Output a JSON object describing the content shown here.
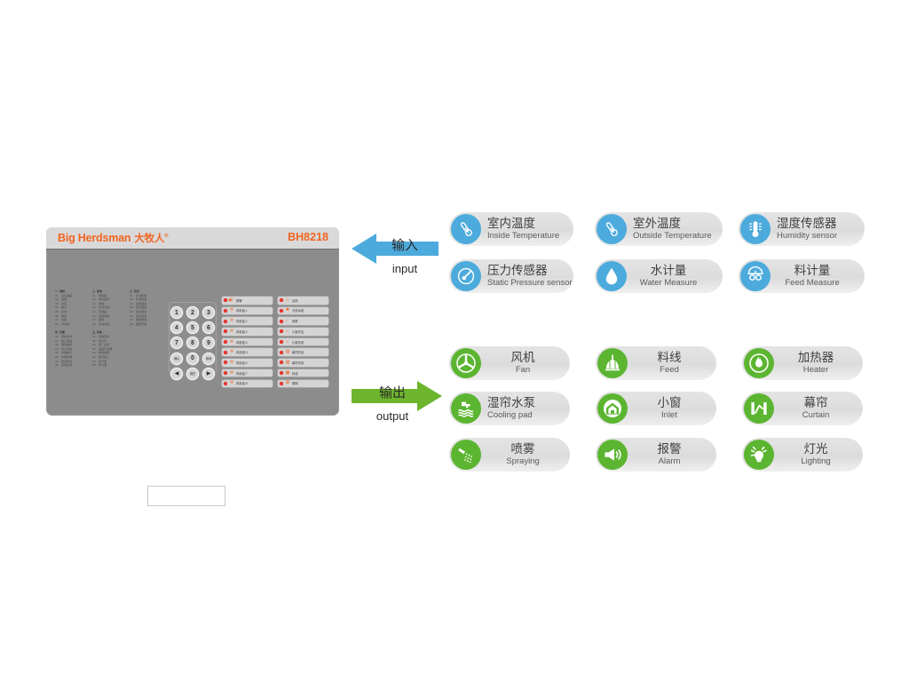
{
  "device": {
    "brand": "Big Herdsman",
    "brand_cn": "大牧人",
    "trademark": "®",
    "model": "BH8218",
    "display_value": "",
    "menu": {
      "groups": [
        {
          "title": "一. 控制",
          "items": [
            {
              "idx": "01",
              "label": "目标温度"
            },
            {
              "idx": "02",
              "label": "湿度"
            },
            {
              "idx": "03",
              "label": "负压"
            },
            {
              "idx": "04",
              "label": "制冷"
            },
            {
              "idx": "05",
              "label": "灯光"
            },
            {
              "idx": "06",
              "label": "饲料"
            },
            {
              "idx": "07",
              "label": "喷雾"
            },
            {
              "idx": "08",
              "label": "风机组"
            }
          ]
        },
        {
          "title": "二. 查询",
          "items": [
            {
              "idx": "11",
              "label": "同机组"
            },
            {
              "idx": "12",
              "label": "同机模式"
            },
            {
              "idx": "13",
              "label": "时钟"
            },
            {
              "idx": "14",
              "label": "生长日龄"
            },
            {
              "idx": "15",
              "label": "折音曲"
            },
            {
              "idx": "16",
              "label": "活用体重"
            },
            {
              "idx": "17",
              "label": "报警"
            },
            {
              "idx": "18",
              "label": "传感校准"
            }
          ]
        },
        {
          "title": "三. 历史",
          "items": [
            {
              "idx": "21",
              "label": "水消耗量"
            },
            {
              "idx": "22",
              "label": "料消耗量"
            },
            {
              "idx": "23",
              "label": "最低温度"
            },
            {
              "idx": "24",
              "label": "最高温度"
            },
            {
              "idx": "25",
              "label": "最低湿度"
            },
            {
              "idx": "26",
              "label": "最高湿度"
            },
            {
              "idx": "27",
              "label": "报警类型"
            },
            {
              "idx": "28",
              "label": "报警开始"
            }
          ]
        }
      ],
      "groups_lower": [
        {
          "title": "四. 设置",
          "items": [
            {
              "idx": "31",
              "label": "更新时间"
            },
            {
              "idx": "32",
              "label": "窗口温度"
            },
            {
              "idx": "33",
              "label": "温度曲线"
            },
            {
              "idx": "34",
              "label": "窗口体重"
            },
            {
              "idx": "35",
              "label": "水量单元"
            },
            {
              "idx": "36",
              "label": "水量参数"
            },
            {
              "idx": "37",
              "label": "变速风机"
            },
            {
              "idx": "38",
              "label": "系统设置"
            }
          ]
        },
        {
          "title": "五. 系统",
          "items": [
            {
              "idx": "61",
              "label": "系统密码"
            },
            {
              "idx": "62",
              "label": "级水平"
            },
            {
              "idx": "63",
              "label": "出厂设置"
            },
            {
              "idx": "64",
              "label": "温度传感器"
            },
            {
              "idx": "65",
              "label": "响音类型"
            },
            {
              "idx": "66",
              "label": "数字输入"
            },
            {
              "idx": "67",
              "label": "水计量"
            },
            {
              "idx": "68",
              "label": "料计量"
            }
          ]
        }
      ]
    },
    "keypad": {
      "rows": [
        [
          "1",
          "2",
          "3"
        ],
        [
          "4",
          "5",
          "6"
        ],
        [
          "7",
          "8",
          "9"
        ],
        [
          "确认",
          "0",
          "取消"
        ],
        [
          "◀",
          "模式",
          "▶"
        ]
      ]
    },
    "indicators": {
      "column_left": [
        {
          "label": "报警",
          "icon": "alarm-horn-icon"
        },
        {
          "label": "风机组 1",
          "icon": "fan-icon"
        },
        {
          "label": "风机组 2",
          "icon": "fan-icon"
        },
        {
          "label": "风机组 3",
          "icon": "fan-icon"
        },
        {
          "label": "风机组 4",
          "icon": "fan-icon"
        },
        {
          "label": "风机组 5",
          "icon": "fan-icon"
        },
        {
          "label": "风机组 6",
          "icon": "fan-icon"
        },
        {
          "label": "风机组 7",
          "icon": "fan-icon"
        },
        {
          "label": "风机组 8",
          "icon": "fan-icon"
        }
      ],
      "column_right": [
        {
          "label": "加热",
          "icon": "flame-icon"
        },
        {
          "label": "冷却水泵",
          "icon": "pump-icon"
        },
        {
          "label": "喷雾",
          "icon": "spray-icon"
        },
        {
          "label": "小窗开启",
          "icon": "inlet-open-icon"
        },
        {
          "label": "小窗关闭",
          "icon": "inlet-close-icon"
        },
        {
          "label": "幕帘开启",
          "icon": "curtain-open-icon"
        },
        {
          "label": "幕帘关闭",
          "icon": "curtain-close-icon"
        },
        {
          "label": "料线",
          "icon": "feed-line-icon"
        },
        {
          "label": "照明",
          "icon": "light-icon"
        }
      ],
      "led_color": "#e8342a"
    }
  },
  "arrows": {
    "input": {
      "cn": "输入",
      "en": "input",
      "color": "#4cabdc",
      "direction": "left"
    },
    "output": {
      "cn": "输出",
      "en": "output",
      "color": "#6cb52d",
      "direction": "right"
    }
  },
  "inputs": {
    "accent": "#4cabdc",
    "cards": [
      {
        "cn": "室内温度",
        "en": "Inside Temperature",
        "icon": "thermometer-icon"
      },
      {
        "cn": "室外温度",
        "en": "Outside Temperature",
        "icon": "thermometer-icon"
      },
      {
        "cn": "湿度传感器",
        "en": "Humidity sensor",
        "icon": "humidity-thermometer-icon"
      },
      {
        "cn": "压力传感器",
        "en": "Static Pressure sensor",
        "icon": "gauge-icon"
      },
      {
        "cn": "水计量",
        "en": "Water Measure",
        "icon": "water-drop-icon"
      },
      {
        "cn": "料计量",
        "en": "Feed Measure",
        "icon": "scale-icon"
      }
    ]
  },
  "outputs": {
    "accent": "#5cb531",
    "cards": [
      {
        "cn": "风机",
        "en": "Fan",
        "icon": "fan-icon"
      },
      {
        "cn": "料线",
        "en": "Feed",
        "icon": "feed-icon"
      },
      {
        "cn": "加热器",
        "en": "Heater",
        "icon": "flame-icon"
      },
      {
        "cn": "湿帘水泵",
        "en": "Cooling pad",
        "icon": "faucet-water-icon"
      },
      {
        "cn": "小窗",
        "en": "Inlet",
        "icon": "inlet-house-icon"
      },
      {
        "cn": "幕帘",
        "en": "Curtain",
        "icon": "curtain-icon"
      },
      {
        "cn": "喷雾",
        "en": "Spraying",
        "icon": "spray-nozzle-icon"
      },
      {
        "cn": "报警",
        "en": "Alarm",
        "icon": "megaphone-icon"
      },
      {
        "cn": "灯光",
        "en": "Lighting",
        "icon": "lightbulb-icon"
      }
    ]
  }
}
